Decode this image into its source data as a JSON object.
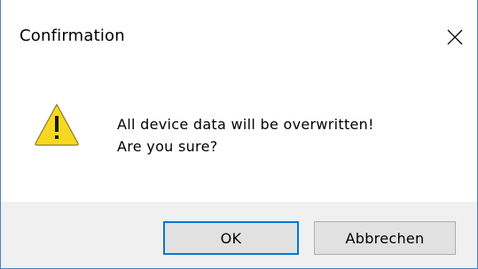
{
  "dialog": {
    "title": "Confirmation",
    "close_icon": "close-icon",
    "icon": "warning-icon",
    "message_line1": "All device data will be overwritten!",
    "message_line2": "Are you sure?",
    "ok_label": "OK",
    "cancel_label": "Abbrechen"
  },
  "colors": {
    "window_border": "#4a7fc1",
    "footer_bg": "#f0f0f0",
    "button_bg": "#e1e1e1",
    "default_button_border": "#0078d7",
    "warning_yellow": "#f8d81f"
  }
}
